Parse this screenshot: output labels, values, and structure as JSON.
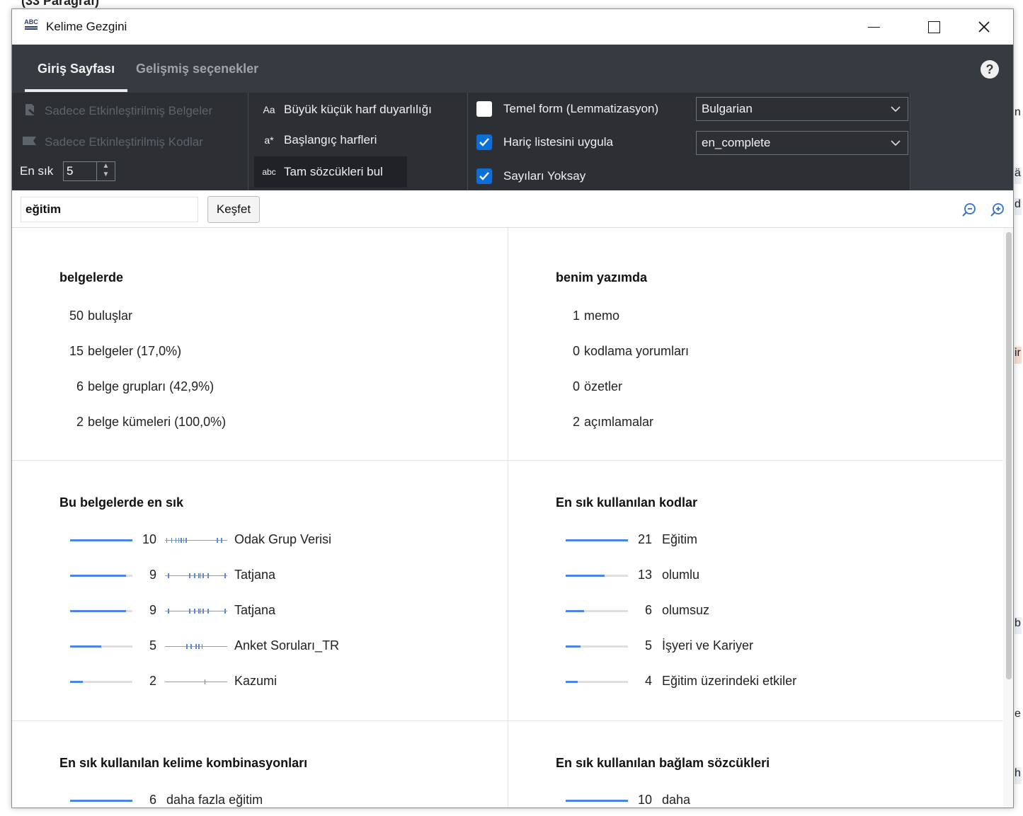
{
  "background": {
    "top_text": "(33 Paragraf)",
    "right_chips": [
      "n",
      "ä",
      "d",
      "ir",
      "b",
      "e",
      "h"
    ]
  },
  "window": {
    "title": "Kelime Gezgini"
  },
  "tabs": [
    {
      "label": "Giriş Sayfası",
      "active": true
    },
    {
      "label": "Gelişmiş seçenekler",
      "active": false
    }
  ],
  "help_label": "?",
  "options": {
    "only_activated_docs": "Sadece Etkinleştirilmiş Belgeler",
    "only_activated_codes": "Sadece Etkinleştirilmiş Kodlar",
    "most_frequent_label": "En sık",
    "most_frequent_value": "5",
    "case_sensitive": {
      "icon": "Aa",
      "label": "Büyük küçük harf duyarlılığı"
    },
    "start_letters": {
      "icon": "a*",
      "label": "Başlangıç harfleri"
    },
    "whole_words": {
      "icon": "abc",
      "label": "Tam sözcükleri bul"
    },
    "lemmatization": {
      "label": "Temel form (Lemmatizasyon)",
      "checked": false
    },
    "apply_stoplist": {
      "label": "Hariç listesini uygula",
      "checked": true
    },
    "ignore_numbers": {
      "label": "Sayıları Yoksay",
      "checked": true
    },
    "language_select": "Bulgarian",
    "stoplist_select": "en_complete"
  },
  "search": {
    "value": "eğitim",
    "button": "Keşfet"
  },
  "panels": {
    "in_documents": {
      "title": "belgelerde",
      "rows": [
        {
          "num": "50",
          "label": "buluşlar"
        },
        {
          "num": "15",
          "label": "belgeler (17,0%)"
        },
        {
          "num": "6",
          "label": "belge grupları (42,9%)"
        },
        {
          "num": "2",
          "label": "belge kümeleri (100,0%)"
        }
      ]
    },
    "my_writing": {
      "title": "benim yazımda",
      "rows": [
        {
          "num": "1",
          "label": "memo"
        },
        {
          "num": "0",
          "label": "kodlama yorumları"
        },
        {
          "num": "0",
          "label": "özetler"
        },
        {
          "num": "2",
          "label": "açımlamalar"
        }
      ]
    },
    "most_in_docs": {
      "title": "Bu belgelerde en sık",
      "rows": [
        {
          "num": "10",
          "label": "Odak Grup Verisi",
          "fill": 1.0,
          "ticks": [
            0.02,
            0.1,
            0.17,
            0.22,
            0.26,
            0.3,
            0.34,
            0.85,
            0.92
          ]
        },
        {
          "num": "9",
          "label": "Tatjana",
          "fill": 0.9,
          "ticks": [
            0.05,
            0.4,
            0.48,
            0.55,
            0.58,
            0.62,
            0.7,
            0.98
          ]
        },
        {
          "num": "9",
          "label": "Tatjana",
          "fill": 0.9,
          "ticks": [
            0.05,
            0.4,
            0.48,
            0.55,
            0.58,
            0.62,
            0.7,
            0.98
          ]
        },
        {
          "num": "5",
          "label": "Anket Soruları_TR",
          "fill": 0.5,
          "ticks": [
            0.35,
            0.42,
            0.5,
            0.55,
            0.6
          ]
        },
        {
          "num": "2",
          "label": "Kazumi",
          "fill": 0.2,
          "ticks": [
            0.65
          ]
        }
      ]
    },
    "most_codes": {
      "title": "En sık kullanılan kodlar",
      "rows": [
        {
          "num": "21",
          "label": "Eğitim",
          "fill": 1.0
        },
        {
          "num": "13",
          "label": "olumlu",
          "fill": 0.62
        },
        {
          "num": "6",
          "label": "olumsuz",
          "fill": 0.29
        },
        {
          "num": "5",
          "label": "İşyeri ve Kariyer",
          "fill": 0.24
        },
        {
          "num": "4",
          "label": "Eğitim üzerindeki etkiler",
          "fill": 0.19
        }
      ]
    },
    "word_combos": {
      "title": "En sık kullanılan kelime kombinasyonları",
      "rows": [
        {
          "num": "6",
          "label": "daha fazla eğitim",
          "fill": 1.0
        }
      ]
    },
    "context_words": {
      "title": "En sık kullanılan bağlam sözcükleri",
      "rows": [
        {
          "num": "10",
          "label": "daha",
          "fill": 1.0
        }
      ]
    }
  },
  "colors": {
    "ribbon": "#363b41",
    "accent": "#4a86e8",
    "checkbox": "#0a6fd8"
  }
}
